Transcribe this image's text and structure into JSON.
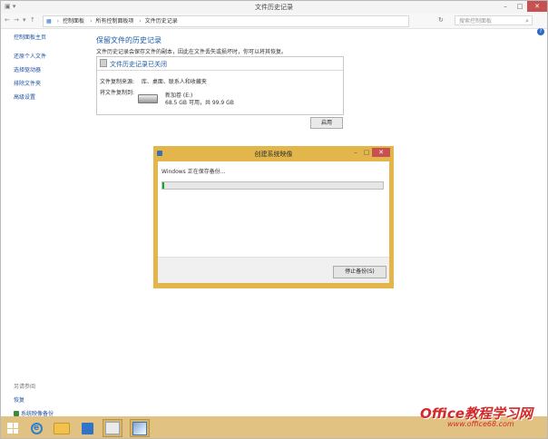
{
  "window": {
    "title": "文件历史记录",
    "address": [
      "控制面板",
      "所有控制面板项",
      "文件历史记录"
    ],
    "search_placeholder": "搜索控制面板"
  },
  "leftnav": {
    "home": "控制面板主页",
    "items": [
      "还原个人文件",
      "选择驱动器",
      "排除文件夹",
      "高级设置"
    ]
  },
  "see_also": {
    "header": "另请参阅",
    "items": [
      "恢复",
      "系统映像备份"
    ]
  },
  "main": {
    "heading": "保留文件的历史记录",
    "description": "文件历史记录会保存文件的副本，因此在文件丢失或损坏时，你可以将其恢复。",
    "status_title": "文件历史记录已关闭",
    "copy_from_label": "文件复制来源:",
    "copy_from_value": "库、桌面、联系人和收藏夹",
    "copy_to_label": "将文件复制到:",
    "drive_name": "新加卷 (E:)",
    "drive_size": "68.5 GB 可用，共 99.9 GB",
    "enable_button": "启用"
  },
  "dialog": {
    "title": "创建系统映像",
    "status": "Windows 正在保存备份...",
    "progress": 0.01,
    "stop_button": "停止备份(S)"
  },
  "taskbar": {
    "icons": [
      "windows-start-icon",
      "internet-explorer-icon",
      "file-explorer-icon",
      "store-app-icon",
      "control-panel-icon",
      "system-image-icon"
    ]
  },
  "watermark": {
    "text": "Office教程学习网",
    "url": "www.office68.com"
  },
  "colors": {
    "accent_blue": "#1c5aa6",
    "dialog_frame": "#e3b64c",
    "taskbar": "#e2c283",
    "progress_green": "#06b025",
    "close_red": "#c75050"
  }
}
